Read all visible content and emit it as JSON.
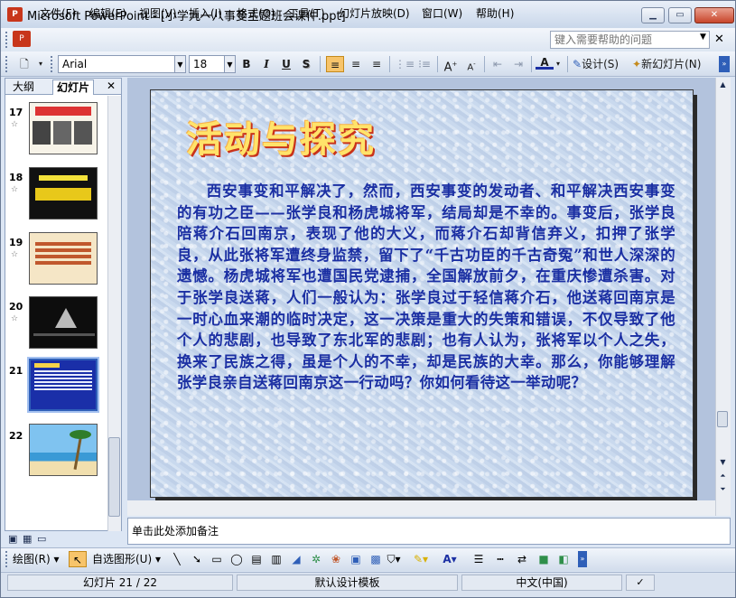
{
  "window": {
    "title": "Microsoft PowerPoint - [小学九一八事变主题班会课件.ppt]",
    "app_icon_text": "P"
  },
  "menu": {
    "items": [
      "文件(F)",
      "编辑(E)",
      "视图(V)",
      "插入(I)",
      "格式(O)",
      "工具(T)",
      "幻灯片放映(D)",
      "窗口(W)",
      "帮助(H)"
    ],
    "help_placeholder": "键入需要帮助的问题"
  },
  "toolbar": {
    "font_name": "Arial",
    "font_size": "18",
    "design_label": "设计(S)",
    "new_slide_label": "新幻灯片(N)"
  },
  "left_pane": {
    "tabs": [
      "大纲",
      "幻灯片"
    ],
    "selected_tab": "幻灯片",
    "slides": [
      {
        "number": "17",
        "has_star": true
      },
      {
        "number": "18",
        "has_star": true
      },
      {
        "number": "19",
        "has_star": true
      },
      {
        "number": "20",
        "has_star": true
      },
      {
        "number": "21",
        "has_star": false
      },
      {
        "number": "22",
        "has_star": false
      }
    ],
    "selected_slide": "21"
  },
  "slide": {
    "title": "活动与探究",
    "body": "西安事变和平解决了，然而，西安事变的发动者、和平解决西安事变的有功之臣——张学良和杨虎城将军，结局却是不幸的。事变后，张学良陪蒋介石回南京，表现了他的大义，而蒋介石却背信弃义，扣押了张学良，从此张将军遭终身监禁，留下了“千古功臣的千古奇冤”和世人深深的遗憾。杨虎城将军也遭国民党逮捕，全国解放前夕，在重庆惨遭杀害。对于张学良送蒋，人们一般认为：张学良过于轻信蒋介石，他送蒋回南京是一时心血来潮的临时决定，这一决策是重大的失策和错误，不仅导致了他个人的悲剧，也导致了东北军的悲剧；也有人认为，张将军以个人之失，换来了民族之得，虽是个人的不幸，却是民族的大幸。那么，你能够理解张学良亲自送蒋回南京这一行动吗？你如何看待这一举动呢？"
  },
  "notes": {
    "placeholder": "单击此处添加备注"
  },
  "draw_toolbar": {
    "draw_label": "绘图(R)",
    "autoshapes_label": "自选图形(U)"
  },
  "status": {
    "slide_info": "幻灯片 21 / 22",
    "template": "默认设计模板",
    "language": "中文(中国)"
  }
}
